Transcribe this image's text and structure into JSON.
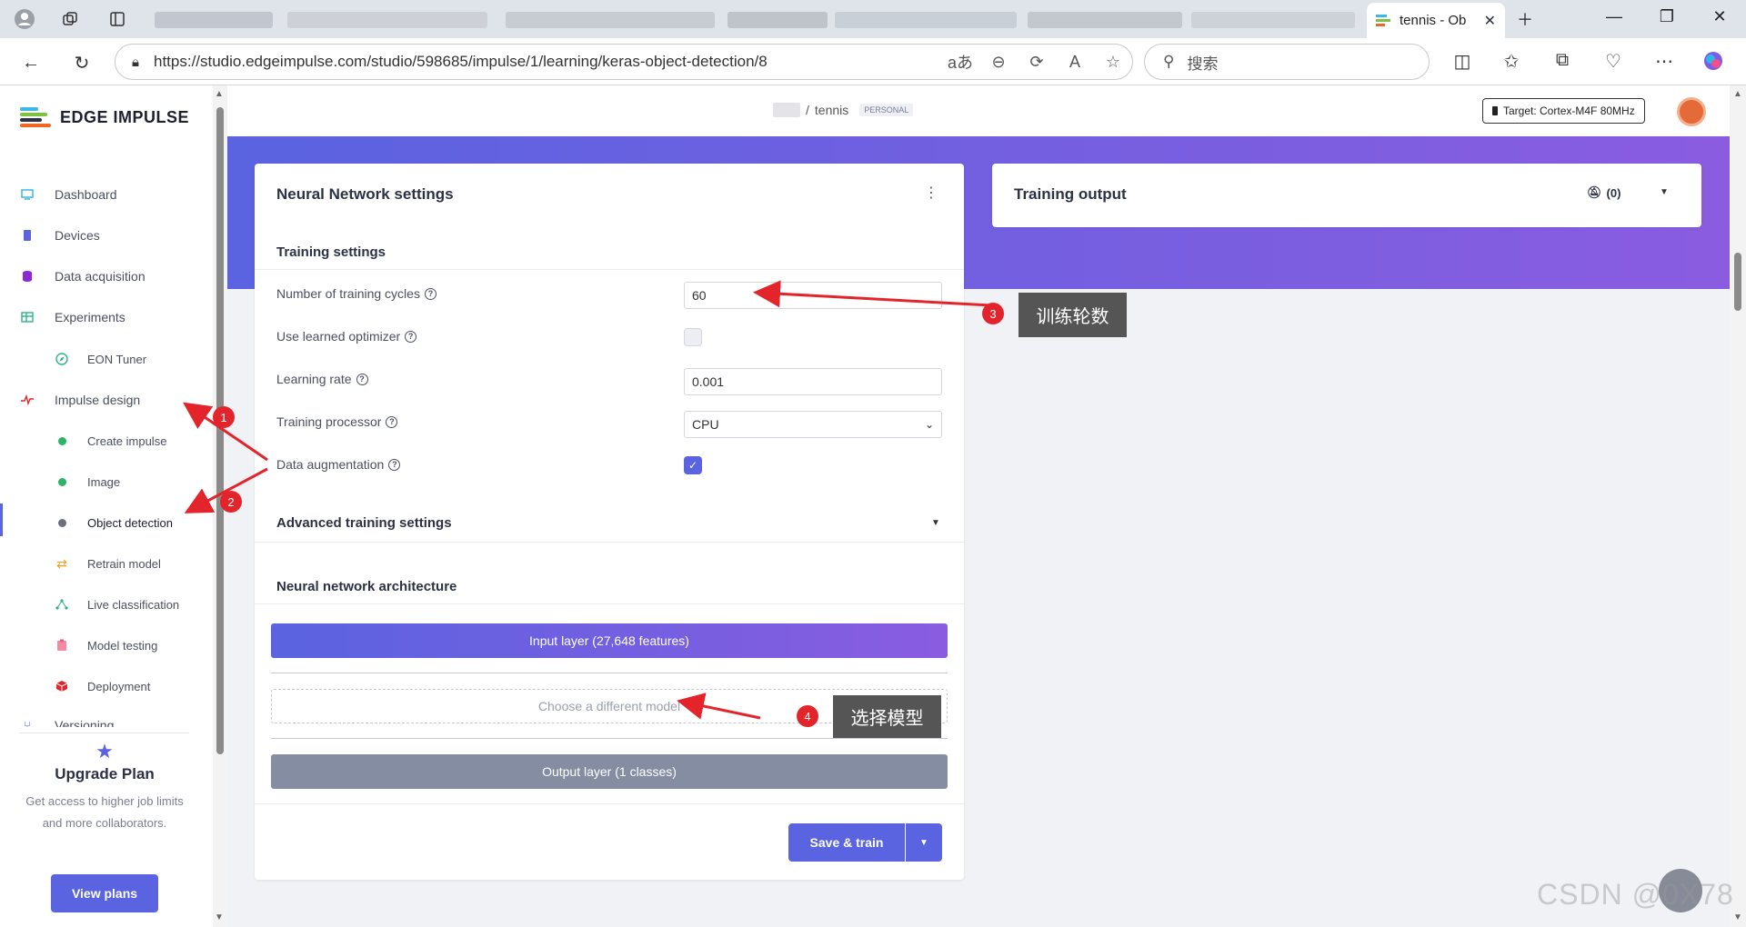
{
  "browser": {
    "active_tab_title": "tennis - Ob",
    "url": "https://studio.edgeimpulse.com/studio/598685/impulse/1/learning/keras-object-detection/8",
    "search_placeholder": "搜索"
  },
  "app": {
    "logo_text": "EDGE IMPULSE",
    "breadcrumb_sep": "/",
    "project": "tennis",
    "project_badge": "PERSONAL",
    "target": "Target: Cortex-M4F 80MHz"
  },
  "sidebar": {
    "items": [
      {
        "label": "Dashboard"
      },
      {
        "label": "Devices"
      },
      {
        "label": "Data acquisition"
      },
      {
        "label": "Experiments"
      },
      {
        "label": "EON Tuner"
      },
      {
        "label": "Impulse design"
      },
      {
        "label": "Create impulse"
      },
      {
        "label": "Image"
      },
      {
        "label": "Object detection"
      },
      {
        "label": "Retrain model"
      },
      {
        "label": "Live classification"
      },
      {
        "label": "Model testing"
      },
      {
        "label": "Deployment"
      },
      {
        "label": "Versioning"
      }
    ],
    "upgrade_title": "Upgrade Plan",
    "upgrade_desc": "Get access to higher job limits and more collaborators.",
    "view_plans": "View plans"
  },
  "nn_settings": {
    "title": "Neural Network settings",
    "training_settings": "Training settings",
    "cycles_label": "Number of training cycles",
    "cycles_value": "60",
    "optimizer_label": "Use learned optimizer",
    "lr_label": "Learning rate",
    "lr_value": "0.001",
    "processor_label": "Training processor",
    "processor_value": "CPU",
    "aug_label": "Data augmentation",
    "advanced": "Advanced training settings",
    "arch_title": "Neural network architecture",
    "input_layer": "Input layer (27,648 features)",
    "choose_model": "Choose a different model",
    "output_layer": "Output layer (1 classes)",
    "save_train": "Save & train"
  },
  "training_output": {
    "title": "Training output",
    "count": "(0)"
  },
  "annotations": {
    "n1": "1",
    "n2": "2",
    "n3": "3",
    "n4": "4",
    "label3": "训练轮数",
    "label4": "选择模型"
  },
  "watermark": "CSDN @0X78"
}
